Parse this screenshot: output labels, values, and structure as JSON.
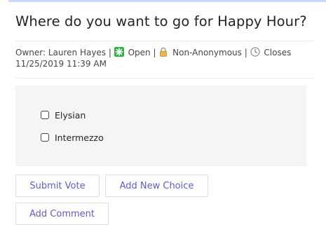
{
  "poll": {
    "title": "Where do you want to go for Happy Hour?",
    "owner_text": "Owner: Lauren Hayes |",
    "status_text": "Open |",
    "anonymity_text": "Non-Anonymous |",
    "closes_text": "Closes",
    "closes_datetime": "11/25/2019 11:39 AM"
  },
  "choices": [
    {
      "label": "Elysian",
      "checked": false
    },
    {
      "label": "Intermezzo",
      "checked": false
    }
  ],
  "buttons": {
    "submit_vote": "Submit Vote",
    "add_new_choice": "Add New Choice",
    "add_comment": "Add Comment"
  },
  "colors": {
    "accent": "#5b5fc7",
    "open_status": "#2fb344",
    "panel_bg": "#f5f5f5"
  },
  "icons": {
    "status": "open-status-icon",
    "anonymity": "lock-icon",
    "closes": "clock-icon"
  }
}
